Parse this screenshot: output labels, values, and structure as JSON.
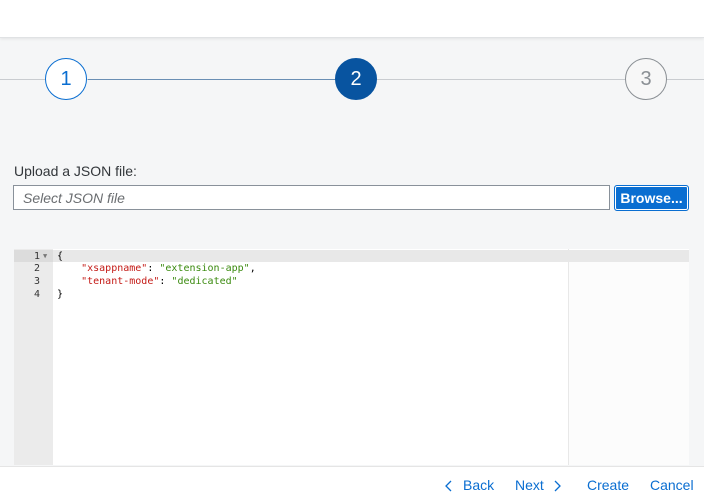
{
  "wizard": {
    "steps": [
      {
        "number": "1",
        "state": "completed"
      },
      {
        "number": "2",
        "state": "current"
      },
      {
        "number": "3",
        "state": "upcoming"
      }
    ]
  },
  "upload": {
    "label": "Upload a JSON file:",
    "placeholder": "Select JSON file",
    "browse_label": "Browse..."
  },
  "editor": {
    "line_numbers": [
      "1",
      "2",
      "3",
      "4"
    ],
    "lines": {
      "l1": "{",
      "l2_key": "\"xsappname\"",
      "l2_sep": ": ",
      "l2_val": "\"extension-app\"",
      "l2_end": ",",
      "l3_key": "\"tenant-mode\"",
      "l3_sep": ": ",
      "l3_val": "\"dedicated\"",
      "l4": "}"
    },
    "colors": {
      "key": "#c41a16",
      "value": "#3a8a0e"
    }
  },
  "footer": {
    "back_label": "Back",
    "next_label": "Next",
    "create_label": "Create",
    "cancel_label": "Cancel"
  },
  "colors": {
    "accent": "#0a6ed1",
    "current_step": "#0854a0"
  }
}
